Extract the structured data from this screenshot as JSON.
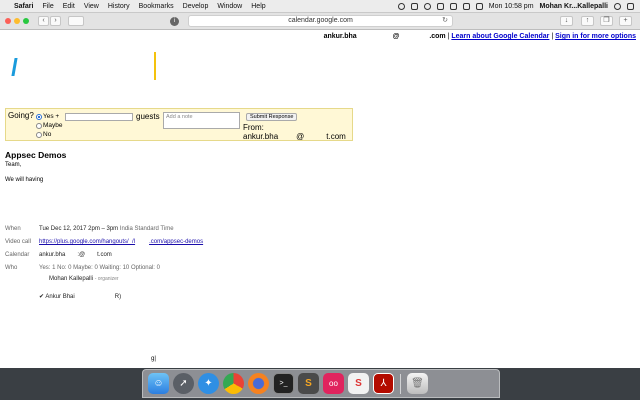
{
  "menubar": {
    "app": "Safari",
    "items": [
      "File",
      "Edit",
      "View",
      "History",
      "Bookmarks",
      "Develop",
      "Window",
      "Help"
    ],
    "clock": "Mon 10:58 pm",
    "user": "Mohan Kr...Kallepalli"
  },
  "toolbar": {
    "url": "calendar.google.com",
    "back_glyph": "‹",
    "fwd_glyph": "›"
  },
  "page": {
    "top_user": "ankur.bha",
    "top_at": "@",
    "top_domain": ".com",
    "link_learn": "Learn about Google Calendar",
    "link_signin": "Sign in for more options",
    "rsvp": {
      "going_label": "Going?",
      "yes": "Yes +",
      "maybe": "Maybe",
      "no": "No",
      "guests": "guests",
      "note_placeholder": "Add a note",
      "submit": "Submit Response",
      "from_label": "From:",
      "from_user": "ankur.bha",
      "from_at": "@",
      "from_domain": "t.com"
    },
    "event_title": "Appsec Demos",
    "body_line1": "Team,",
    "body_line2": "We will having",
    "when_label": "When",
    "when_value": "Tue Dec 12, 2017 2pm – 3pm",
    "when_tz": "India Standard Time",
    "video_label": "Video call",
    "video_link_a": "https://plus.google.com/hangouts/_/l",
    "video_link_b": ".com/appsec-demos",
    "calendar_label": "Calendar",
    "calendar_user": "ankur.bha",
    "calendar_at": ":@",
    "calendar_domain": "t.com",
    "who_label": "Who",
    "who_counts": "Yes: 1  No: 0  Maybe: 0  Waiting: 10  Optional: 0",
    "organizer_name": "Mohan Kallepalli",
    "organizer_tag": "- organizer",
    "attendee_name": "Ankur Bhai",
    "attendee_suffix": "R)",
    "bottom_glyph": "g|"
  },
  "dock": {
    "apps": [
      "finder-icon",
      "launchpad-icon",
      "safari-icon",
      "chrome-icon",
      "firefox-icon",
      "terminal-icon",
      "sublime-icon",
      "flickr-icon",
      "sketchbook-icon",
      "acrobat-icon"
    ],
    "trash": "trash-icon"
  }
}
